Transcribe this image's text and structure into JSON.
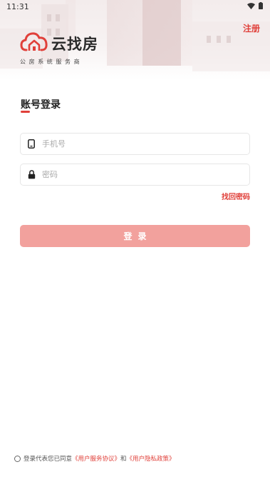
{
  "status_bar": {
    "time": "11:31",
    "icons": [
      "wifi-icon",
      "battery-icon"
    ]
  },
  "header": {
    "register_label": "注册"
  },
  "logo": {
    "name": "云找房",
    "subtitle": "公房系统服务商",
    "icon": "cloud-house-icon"
  },
  "login": {
    "title": "账号登录",
    "phone_placeholder": "手机号",
    "phone_icon": "phone-icon",
    "password_placeholder": "密码",
    "password_icon": "lock-icon",
    "forgot_label": "找回密码",
    "submit_label": "登录"
  },
  "agreement": {
    "prefix": "登录代表您已同意",
    "user_agreement": "《用户服务协议》",
    "conjunction": "和",
    "privacy_policy": "《用户隐私政策》"
  },
  "colors": {
    "accent": "#e0403a",
    "button": "#f2a19d",
    "text": "#222222"
  }
}
